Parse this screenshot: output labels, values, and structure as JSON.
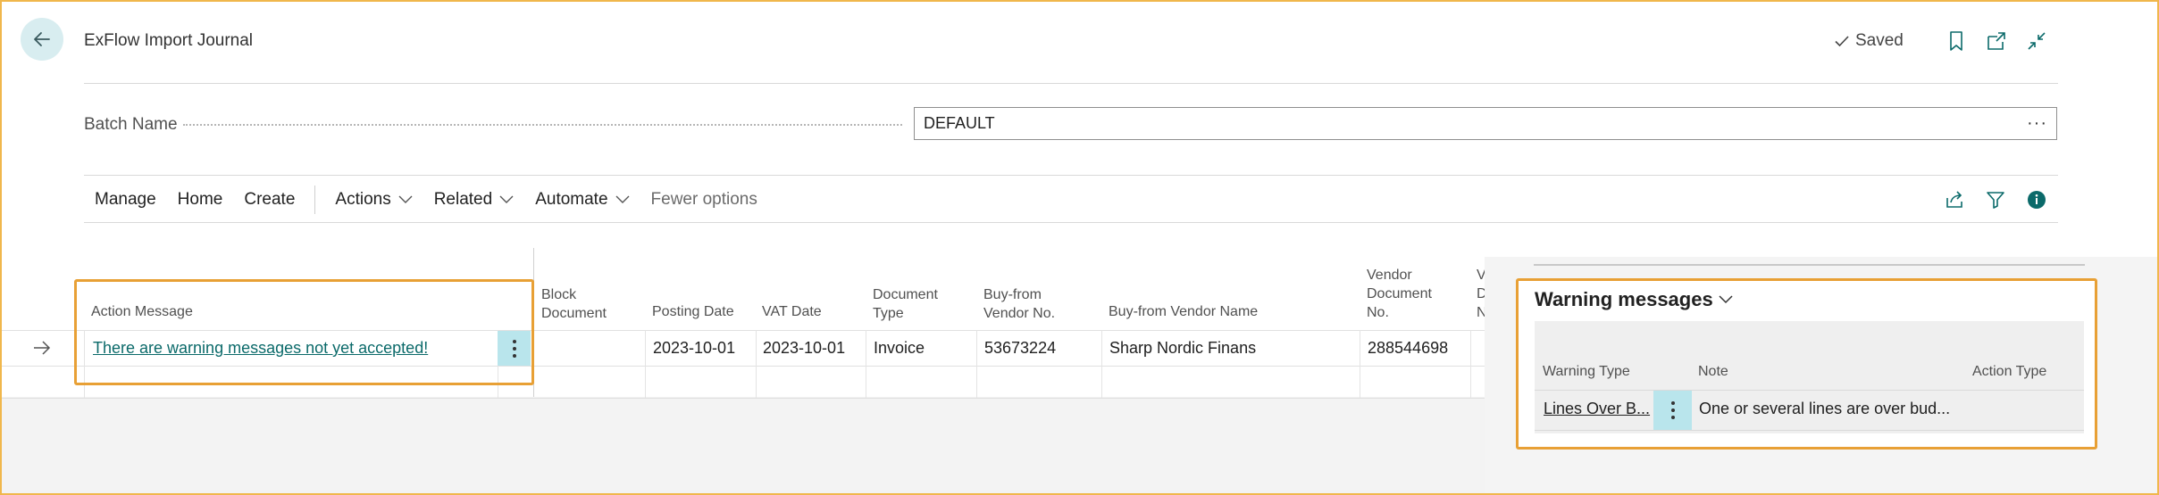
{
  "header": {
    "title": "ExFlow Import Journal",
    "saved_label": "Saved"
  },
  "batch": {
    "label": "Batch Name",
    "value": "DEFAULT"
  },
  "menu": {
    "items": [
      "Manage",
      "Home",
      "Create"
    ],
    "dropdowns": [
      "Actions",
      "Related",
      "Automate"
    ],
    "fewer": "Fewer options"
  },
  "grid": {
    "headers": {
      "action_message": "Action Message",
      "block_document": [
        "Block",
        "Document"
      ],
      "posting_date": "Posting Date",
      "vat_date": "VAT Date",
      "document_type": [
        "Document",
        "Type"
      ],
      "vendor_no": [
        "Buy-from",
        "Vendor No."
      ],
      "vendor_name": "Buy-from Vendor Name",
      "vendor_doc_no": [
        "Vendor",
        "Document",
        "No."
      ],
      "next_col": [
        "V",
        "D",
        "N"
      ]
    },
    "row": {
      "action_message": "There are warning messages not yet accepted!",
      "block_document": "",
      "posting_date": "2023-10-01",
      "vat_date": "2023-10-01",
      "document_type": "Invoice",
      "vendor_no": "53673224",
      "vendor_name": "Sharp Nordic Finans",
      "vendor_doc_no": "288544698"
    }
  },
  "warnings": {
    "title": "Warning messages",
    "headers": {
      "warning_type": "Warning Type",
      "note": "Note",
      "action_type": "Action Type"
    },
    "row": {
      "warning_type": "Lines Over B...",
      "note": "One or several lines are over bud...",
      "action_type": ""
    }
  },
  "colors": {
    "accent": "#0b6a6a",
    "highlight_border": "#e8a035",
    "kebab_bg": "#b9e5ec",
    "back_button_bg": "#d8edf0"
  }
}
